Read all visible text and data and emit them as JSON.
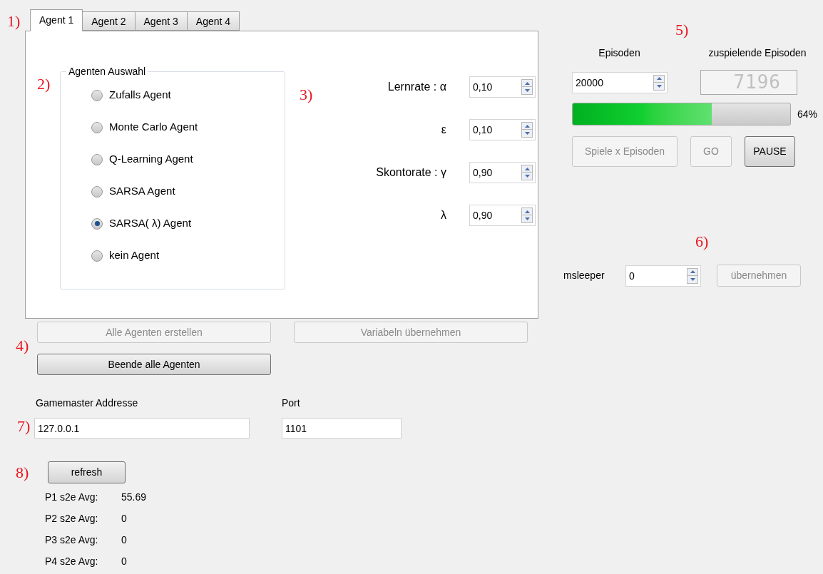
{
  "annotations": [
    "1)",
    "2)",
    "3)",
    "4)",
    "5)",
    "6)",
    "7)",
    "8)"
  ],
  "tabs": [
    {
      "label": "Agent 1",
      "selected": true
    },
    {
      "label": "Agent 2",
      "selected": false
    },
    {
      "label": "Agent 3",
      "selected": false
    },
    {
      "label": "Agent 4",
      "selected": false
    }
  ],
  "agent_group": {
    "title": "Agenten Auswahl",
    "options": [
      {
        "label": "Zufalls Agent",
        "selected": false
      },
      {
        "label": "Monte Carlo Agent",
        "selected": false
      },
      {
        "label": "Q-Learning Agent",
        "selected": false
      },
      {
        "label": "SARSA Agent",
        "selected": false
      },
      {
        "label": "SARSA( λ) Agent",
        "selected": true
      },
      {
        "label": "kein Agent",
        "selected": false
      }
    ]
  },
  "parameters": [
    {
      "label": "Lernrate : α",
      "value": "0,10"
    },
    {
      "label": "ε",
      "value": "0,10"
    },
    {
      "label": "Skontorate : γ",
      "value": "0,90"
    },
    {
      "label": "λ",
      "value": "0,90"
    }
  ],
  "agent_buttons": [
    {
      "label": "Alle Agenten erstellen",
      "disabled": true
    },
    {
      "label": "Variabeln übernehmen",
      "disabled": true
    },
    {
      "label": "Beende alle Agenten",
      "disabled": false
    }
  ],
  "connection": {
    "address_label": "Gamemaster Addresse",
    "address": "127.0.0.1",
    "port_label": "Port",
    "port": "1101"
  },
  "refresh_button": {
    "label": "refresh",
    "disabled": false
  },
  "stats": [
    {
      "label": "P1 s2e Avg:",
      "value": "55.69"
    },
    {
      "label": "P2 s2e Avg:",
      "value": "0"
    },
    {
      "label": "P3 s2e Avg:",
      "value": "0"
    },
    {
      "label": "P4 s2e Avg:",
      "value": "0"
    }
  ],
  "episodes": {
    "label": "Episoden",
    "value": "20000",
    "remaining_label": "zuspielende Episoden",
    "remaining": "7196"
  },
  "progress": {
    "level": 0.64,
    "reading": "64%"
  },
  "episode_buttons": [
    {
      "label": "Spiele x Episoden",
      "disabled": true
    },
    {
      "label": "GO",
      "disabled": true
    },
    {
      "label": "PAUSE",
      "disabled": false
    }
  ],
  "sleeper": {
    "label": "msleeper",
    "value": "0",
    "button": {
      "label": "übernehmen",
      "disabled": true
    }
  }
}
